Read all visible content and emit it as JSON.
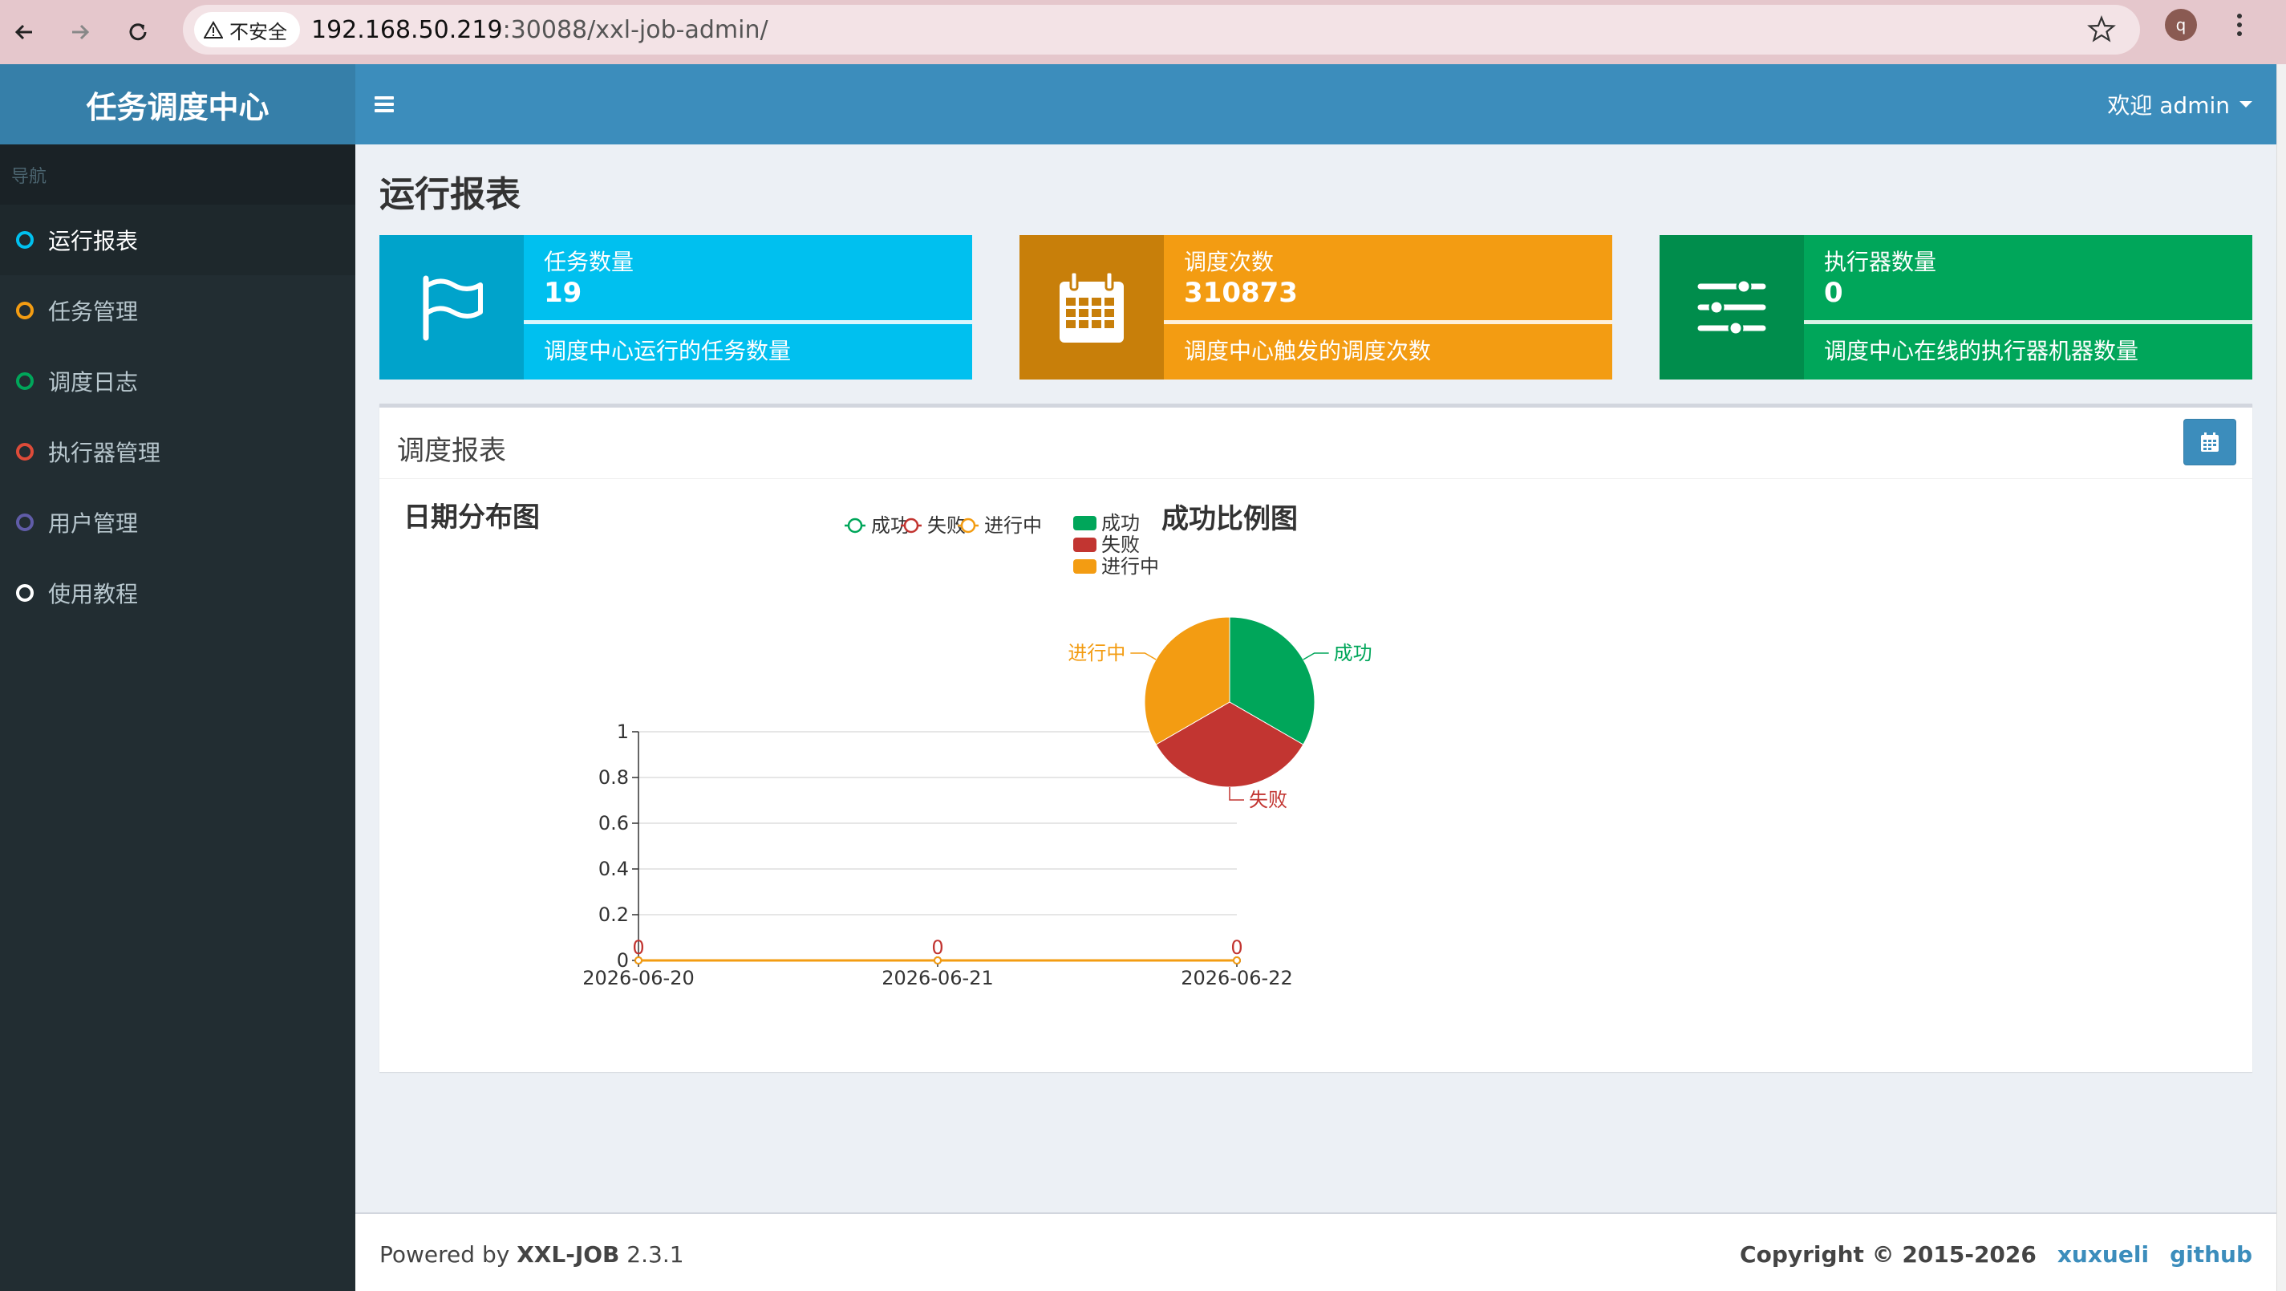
{
  "browser": {
    "insecure_label": "不安全",
    "url_host": "192.168.50.219",
    "url_rest": ":30088/xxl-job-admin/",
    "profile_initial": "q"
  },
  "sidebar": {
    "logo": "任务调度中心",
    "header": "导航",
    "items": [
      {
        "label": "运行报表",
        "color": "#00c0ef",
        "active": true
      },
      {
        "label": "任务管理",
        "color": "#f39c12",
        "active": false
      },
      {
        "label": "调度日志",
        "color": "#00a65a",
        "active": false
      },
      {
        "label": "执行器管理",
        "color": "#dd4b39",
        "active": false
      },
      {
        "label": "用户管理",
        "color": "#605ca8",
        "active": false
      },
      {
        "label": "使用教程",
        "color": "#ffffff",
        "active": false
      }
    ]
  },
  "header": {
    "user_label": "欢迎 admin"
  },
  "page": {
    "title": "运行报表"
  },
  "info_boxes": [
    {
      "label": "任务数量",
      "value": "19",
      "desc": "调度中心运行的任务数量",
      "icon": "flag-icon",
      "color": "#00c0ef",
      "icon_bg": "#00a3cb"
    },
    {
      "label": "调度次数",
      "value": "310873",
      "desc": "调度中心触发的调度次数",
      "icon": "calendar-icon",
      "color": "#f39c12",
      "icon_bg": "#c87f0a"
    },
    {
      "label": "执行器数量",
      "value": "0",
      "desc": "调度中心在线的执行器机器数量",
      "icon": "sliders-icon",
      "color": "#00a65a",
      "icon_bg": "#008d4c"
    }
  ],
  "report": {
    "title": "调度报表"
  },
  "chart_data": [
    {
      "type": "line",
      "title": "日期分布图",
      "x": [
        "2026-06-20",
        "2026-06-21",
        "2026-06-22"
      ],
      "ylim": [
        0,
        1
      ],
      "yticks": [
        0,
        0.2,
        0.4,
        0.6,
        0.8,
        1
      ],
      "ytick_labels": [
        "0",
        "0.2",
        "0.4",
        "0.6",
        "0.8",
        "1"
      ],
      "legend_position": "top",
      "series": [
        {
          "name": "成功",
          "values": [
            0,
            0,
            0
          ],
          "color": "#00a65a"
        },
        {
          "name": "失败",
          "values": [
            0,
            0,
            0
          ],
          "color": "#c23531"
        },
        {
          "name": "进行中",
          "values": [
            0,
            0,
            0
          ],
          "color": "#f39c12"
        }
      ],
      "data_labels": [
        "0",
        "0",
        "0"
      ],
      "grid": true
    },
    {
      "type": "pie",
      "title": "成功比例图",
      "legend_position": "top-left",
      "labels": [
        "成功",
        "失败",
        "进行中"
      ],
      "values": [
        1,
        1,
        1
      ],
      "colors": [
        "#00a65a",
        "#c23531",
        "#f39c12"
      ]
    }
  ],
  "footer": {
    "powered_prefix": "Powered by ",
    "brand": "XXL-JOB",
    "version": " 2.3.1",
    "copyright": "Copyright © 2015-2026",
    "link_author": "xuxueli",
    "link_github": "github"
  }
}
